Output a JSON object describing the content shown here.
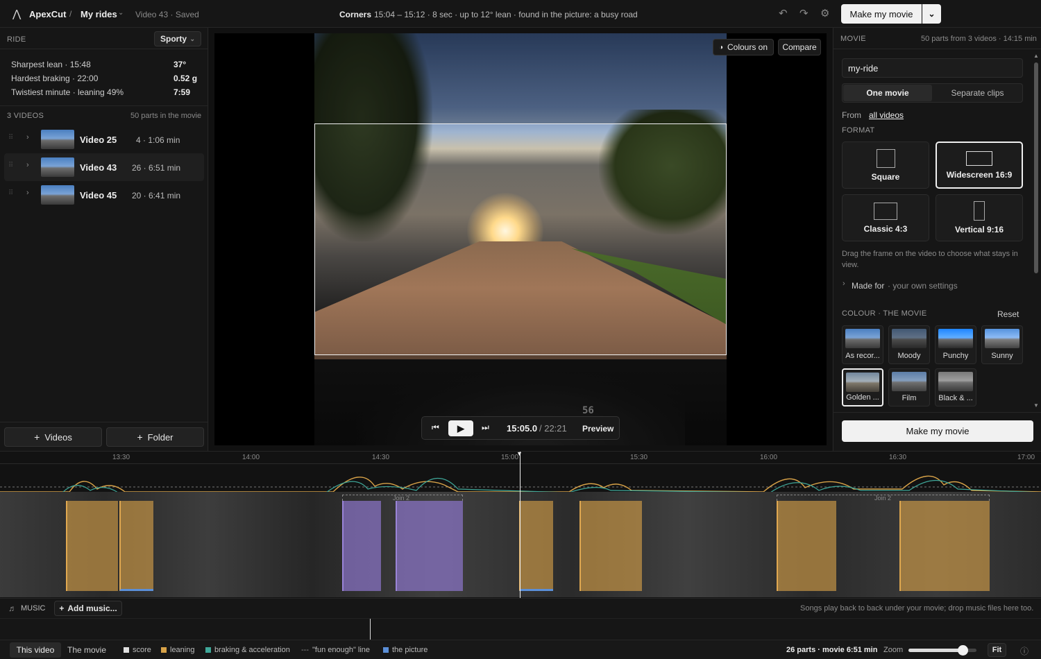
{
  "app": {
    "name": "ApexCut",
    "breadcrumb_project": "My rides",
    "breadcrumb_status": "Video 43 · Saved"
  },
  "header": {
    "segment_title": "Corners",
    "segment_detail": "15:04 – 15:12 · 8 sec · up to 12° lean · found in the picture: a busy road",
    "make_movie_label": "Make my movie"
  },
  "ride": {
    "section_label": "RIDE",
    "mode_label": "Sporty",
    "stats": [
      {
        "label": "Sharpest lean · 15:48",
        "value": "37°"
      },
      {
        "label": "Hardest braking · 22:00",
        "value": "0.52 g"
      },
      {
        "label": "Twistiest minute · leaning 49%",
        "value": "7:59"
      }
    ]
  },
  "videos": {
    "section_label": "3 VIDEOS",
    "section_note": "50 parts in the movie",
    "items": [
      {
        "name": "Video 25",
        "meta": "4 · 1:06 min"
      },
      {
        "name": "Video 43",
        "meta": "26 · 6:51 min"
      },
      {
        "name": "Video 45",
        "meta": "20 · 6:41 min"
      }
    ],
    "add_videos_label": "Videos",
    "add_folder_label": "Folder"
  },
  "viewer": {
    "colours_label": "Colours on",
    "compare_label": "Compare",
    "time_current": "15:05.0",
    "time_total": "/ 22:21",
    "preview_label": "Preview",
    "speedo_text": "56"
  },
  "movie": {
    "section_label": "MOVIE",
    "section_note": "50 parts from 3 videos · 14:15 min",
    "name_value": "my-ride",
    "mode_options": [
      "One movie",
      "Separate clips"
    ],
    "from_label": "From",
    "from_link": "all videos",
    "format_label": "FORMAT",
    "formats": [
      "Square",
      "Widescreen 16:9",
      "Classic 4:3",
      "Vertical 9:16"
    ],
    "format_selected": "Widescreen 16:9",
    "hint": "Drag the frame on the video to choose what stays in view.",
    "made_for_label": "Made for",
    "made_for_value": "· your own settings",
    "colour_label": "COLOUR · THE MOVIE",
    "reset_label": "Reset",
    "presets": [
      "As recor...",
      "Moody",
      "Punchy",
      "Sunny",
      "Golden ...",
      "Film",
      "Black & ..."
    ],
    "preset_selected": "Golden ...",
    "make_movie_label": "Make my movie"
  },
  "timeline": {
    "ticks": [
      "13:30",
      "14:00",
      "14:30",
      "15:00",
      "15:30",
      "16:00",
      "16:30",
      "17:00"
    ],
    "join_labels": [
      "Join 2",
      "Join 2"
    ]
  },
  "music": {
    "label": "MUSIC",
    "add_label": "Add music...",
    "hint": "Songs play back to back under your movie; drop music files here too."
  },
  "status": {
    "tabs": [
      "This video",
      "The movie"
    ],
    "legend": [
      "score",
      "leaning",
      "braking & acceleration",
      "\"fun enough\" line",
      "the picture"
    ],
    "summary": "26 parts · movie 6:51 min",
    "zoom_label": "Zoom",
    "zoom_level": 0.8,
    "fit_label": "Fit"
  },
  "colors": {
    "accent_orange": "#d8a248",
    "accent_purple": "#8a74c8",
    "legend_teal": "#3fa89a",
    "legend_blue": "#5b8fd8"
  }
}
